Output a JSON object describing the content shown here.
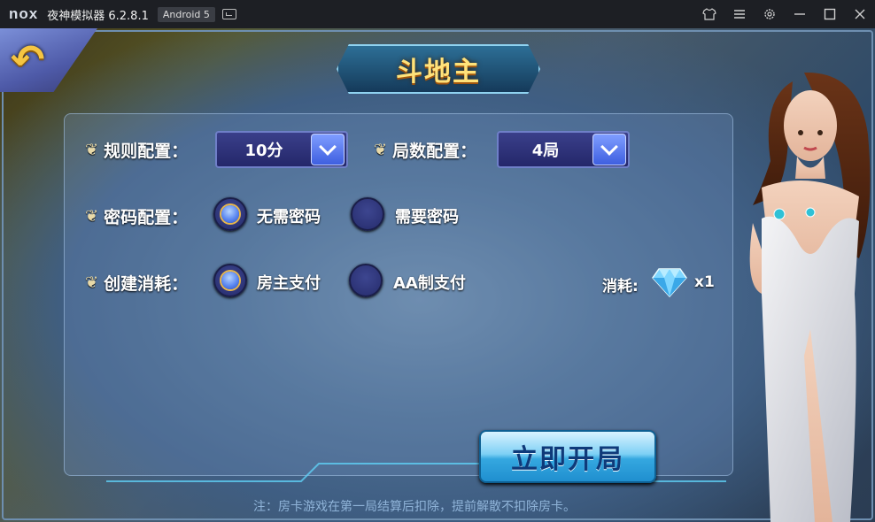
{
  "titlebar": {
    "logo": "nox",
    "app_title": "夜神模拟器 6.2.8.1",
    "android_badge": "Android 5",
    "icons": [
      "screen-icon",
      "shirt-icon",
      "menu-icon",
      "gear-icon",
      "minimize-icon",
      "maximize-icon",
      "close-icon"
    ]
  },
  "game": {
    "title": "斗地主",
    "rules": {
      "rule_label": "规则配置：",
      "rule_value": "10分",
      "rounds_label": "局数配置：",
      "rounds_value": "4局",
      "password_label": "密码配置：",
      "password_options": [
        {
          "label": "无需密码",
          "selected": true
        },
        {
          "label": "需要密码",
          "selected": false
        }
      ],
      "create_label": "创建消耗：",
      "create_options": [
        {
          "label": "房主支付",
          "selected": true
        },
        {
          "label": "AA制支付",
          "selected": false
        }
      ],
      "cost_label": "消耗:",
      "cost_count": "x1"
    },
    "start_button": "立即开局",
    "notice": "注：房卡游戏在第一局结算后扣除，提前解散不扣除房卡。"
  },
  "colors": {
    "title_gold": "#ffe27a",
    "select_bg": "#24276a",
    "start_button_blue": "#35a8e0"
  }
}
